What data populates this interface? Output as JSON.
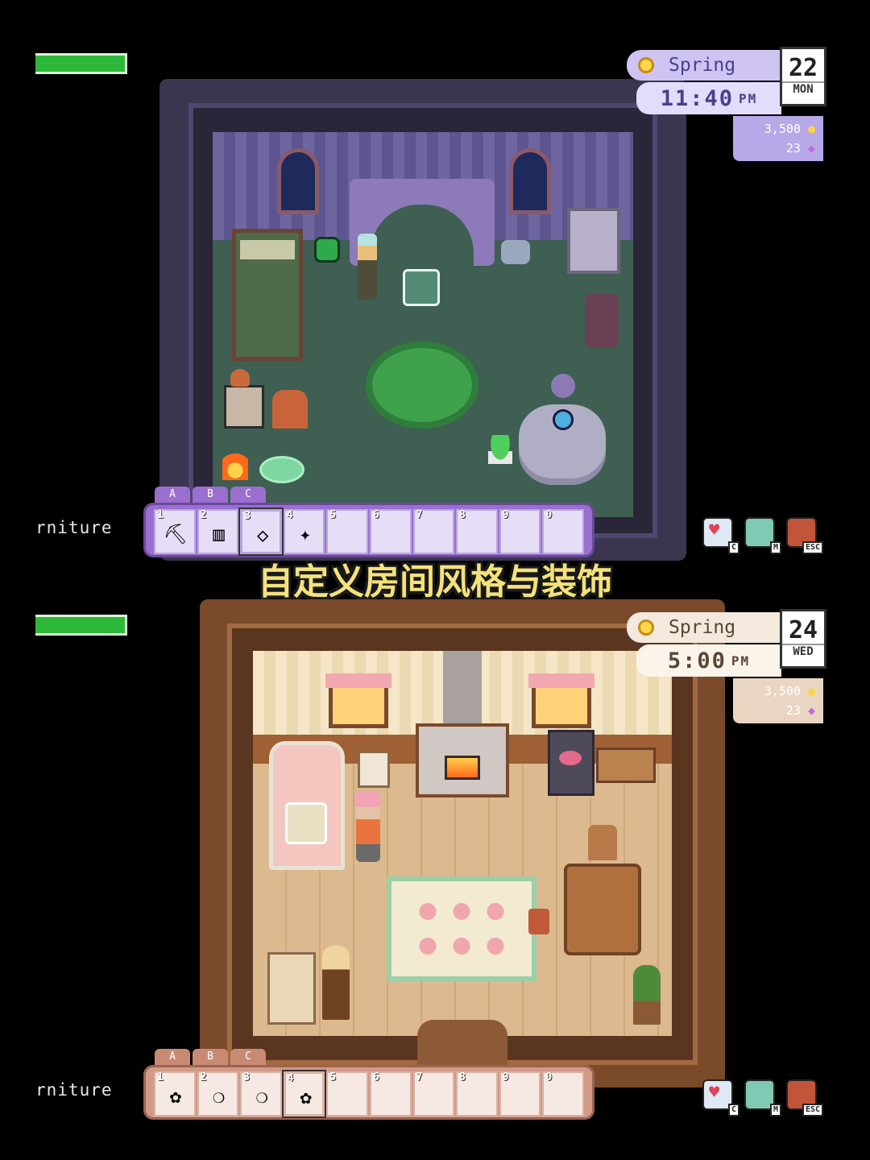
{
  "caption": "自定义房间风格与装饰",
  "top_screen": {
    "hud": {
      "season": "Spring",
      "time": "11:40",
      "ampm": "PM",
      "date_num": "22",
      "date_day": "MON",
      "gold": "3,500",
      "gems": "23"
    },
    "side_label": "rniture",
    "tabs": [
      "A",
      "B",
      "C"
    ],
    "hotbar": [
      {
        "n": "1",
        "icon": "pickaxe-icon",
        "glyph": "⛏"
      },
      {
        "n": "2",
        "icon": "chair-icon",
        "glyph": "▥"
      },
      {
        "n": "3",
        "icon": "crystal-icon",
        "glyph": "◇",
        "selected": true
      },
      {
        "n": "4",
        "icon": "shards-icon",
        "glyph": "✦"
      },
      {
        "n": "5",
        "icon": "",
        "glyph": ""
      },
      {
        "n": "6",
        "icon": "",
        "glyph": ""
      },
      {
        "n": "7",
        "icon": "",
        "glyph": ""
      },
      {
        "n": "8",
        "icon": "",
        "glyph": ""
      },
      {
        "n": "9",
        "icon": "",
        "glyph": ""
      },
      {
        "n": "0",
        "icon": "",
        "glyph": ""
      }
    ],
    "menu_keys": [
      "C",
      "M",
      "ESC"
    ]
  },
  "bottom_screen": {
    "hud": {
      "season": "Spring",
      "time": "5:00",
      "ampm": "PM",
      "date_num": "24",
      "date_day": "WED",
      "gold": "3,500",
      "gems": "23"
    },
    "side_label": "rniture",
    "tabs": [
      "A",
      "B",
      "C"
    ],
    "hotbar": [
      {
        "n": "1",
        "icon": "flower-pot-icon",
        "glyph": "✿"
      },
      {
        "n": "2",
        "icon": "jar-icon",
        "glyph": "❍"
      },
      {
        "n": "3",
        "icon": "jar-icon",
        "glyph": "❍"
      },
      {
        "n": "4",
        "icon": "pink-flower-icon",
        "glyph": "✿",
        "selected": true
      },
      {
        "n": "5",
        "icon": "",
        "glyph": ""
      },
      {
        "n": "6",
        "icon": "",
        "glyph": ""
      },
      {
        "n": "7",
        "icon": "",
        "glyph": ""
      },
      {
        "n": "8",
        "icon": "",
        "glyph": ""
      },
      {
        "n": "9",
        "icon": "",
        "glyph": ""
      },
      {
        "n": "0",
        "icon": "",
        "glyph": ""
      }
    ],
    "menu_keys": [
      "C",
      "M",
      "ESC"
    ]
  },
  "colors": {
    "top_wall": "#4a4466",
    "top_floor": "#3e5f52",
    "bottom_wall": "#8c5a36",
    "bottom_floor": "#d9b48a",
    "hud_lilac": "#cfc3f2",
    "hud_cream": "#f3e9dc"
  }
}
